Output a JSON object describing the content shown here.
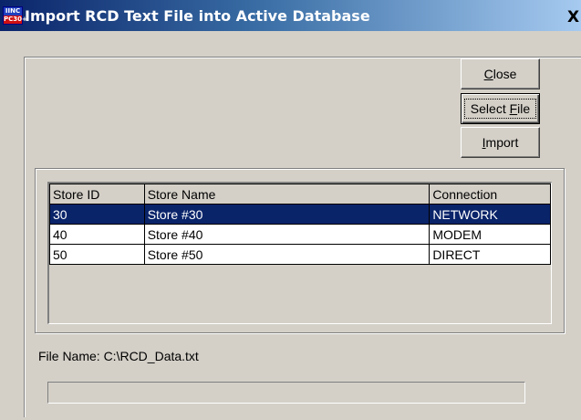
{
  "window": {
    "title": "Import RCD Text File into Active Database",
    "icon_text_top": "IINC",
    "icon_text_bottom": "PC30+",
    "close_glyph": "X"
  },
  "buttons": {
    "close": {
      "mnemonic": "C",
      "rest": "lose"
    },
    "select_file": {
      "pre": "Select ",
      "mnemonic": "F",
      "rest": "ile"
    },
    "import": {
      "mnemonic": "I",
      "rest": "mport"
    }
  },
  "grid": {
    "columns": [
      "Store ID",
      "Store Name",
      "Connection"
    ],
    "rows": [
      {
        "store_id": "30",
        "store_name": "Store #30",
        "connection": "NETWORK",
        "selected": true
      },
      {
        "store_id": "40",
        "store_name": "Store #40",
        "connection": "MODEM",
        "selected": false
      },
      {
        "store_id": "50",
        "store_name": "Store #50",
        "connection": "DIRECT",
        "selected": false
      }
    ]
  },
  "file_name_label": "File Name: C:\\RCD_Data.txt",
  "progress": {
    "fraction": 0
  },
  "colors": {
    "selection": "#0a246a",
    "dialog_face": "#d4d0c8"
  }
}
